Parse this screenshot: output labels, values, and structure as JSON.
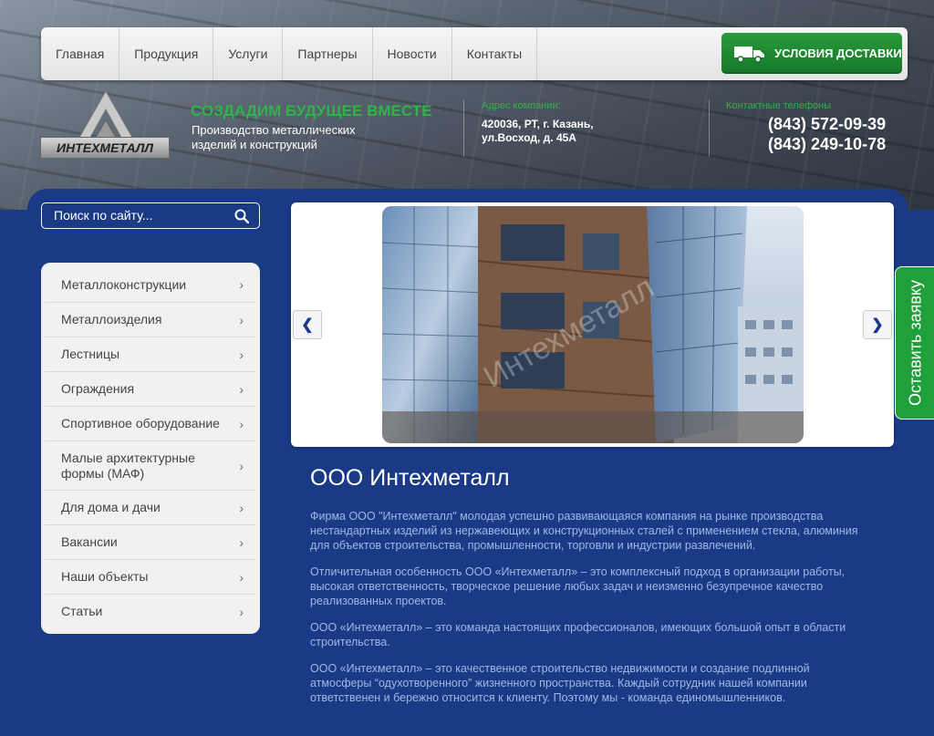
{
  "nav": {
    "items": [
      "Главная",
      "Продукция",
      "Услуги",
      "Партнеры",
      "Новости",
      "Контакты"
    ],
    "delivery_button": "УСЛОВИЯ ДОСТАВКИ"
  },
  "header": {
    "logo_text": "ИНТЕХМЕТАЛЛ",
    "slogan": "СОЗДАДИМ БУДУЩЕЕ ВМЕСТЕ",
    "slogan_sub": "Производство металлических изделий и конструкций",
    "address_label": "Адрес компании:",
    "address": "420036, РТ, г. Казань, ул.Восход, д. 45А",
    "phones_label": "Контактные телефоны",
    "phones": [
      "(843) 572-09-39",
      "(843) 249-10-78"
    ]
  },
  "search": {
    "placeholder": "Поиск по сайту..."
  },
  "sidebar": {
    "items": [
      "Металлоконструкции",
      "Металлоизделия",
      "Лестницы",
      "Ограждения",
      "Спортивное оборудование",
      "Малые архитектурные формы (МАФ)",
      "Для дома и дачи",
      "Вакансии",
      "Наши объекты",
      "Статьи"
    ]
  },
  "slider": {
    "watermark": "Интехметалл"
  },
  "order_tab": "Оставить заявку",
  "content": {
    "title": "ООО Интехметалл",
    "paragraphs": [
      "Фирма ООО \"Интехметалл\" молодая успешно развивающаяся компания на рынке производства нестандартных изделий из нержавеющих и конструкционных сталей с применением стекла, алюминия для объектов строительства, промышленности, торговли и индустрии развлечений.",
      "Отличительная особенность ООО «Интехметалл» – это комплексный подход в организации работы, высокая ответственность, творческое решение любых задач и неизменно безупречное качество  реализованных проектов.",
      "ООО «Интехметалл» – это команда настоящих профессионалов, имеющих большой опыт в области строительства.",
      "ООО «Интехметалл» – это качественное строительство недвижимости и создание подлинной атмосферы “одухотворенного” жизненного пространства. Каждый сотрудник нашей компании ответственен и бережно относится к клиенту. Поэтому мы - команда единомышленников."
    ]
  },
  "colors": {
    "brand_green": "#2fb34a",
    "brand_blue": "#1a3a86"
  }
}
